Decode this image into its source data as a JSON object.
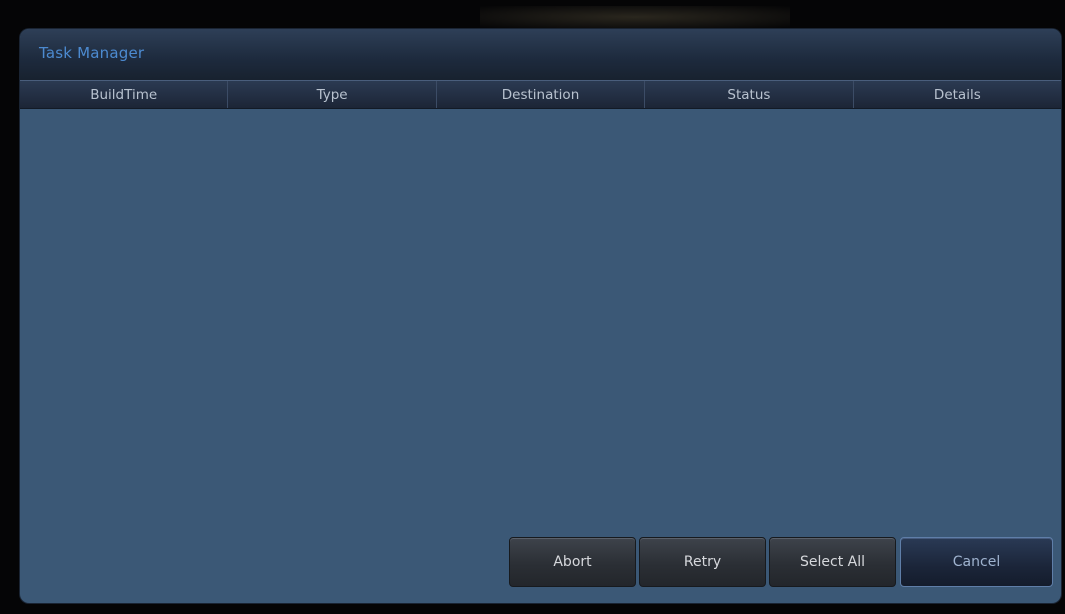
{
  "dialog": {
    "title": "Task Manager"
  },
  "table": {
    "columns": [
      "BuildTime",
      "Type",
      "Destination",
      "Status",
      "Details"
    ],
    "rows": []
  },
  "buttons": {
    "abort": "Abort",
    "retry": "Retry",
    "select_all": "Select All",
    "cancel": "Cancel"
  },
  "colors": {
    "dialog_background": "#3b5876",
    "title_text": "#4c8ad0",
    "screen_background": "#050506"
  }
}
